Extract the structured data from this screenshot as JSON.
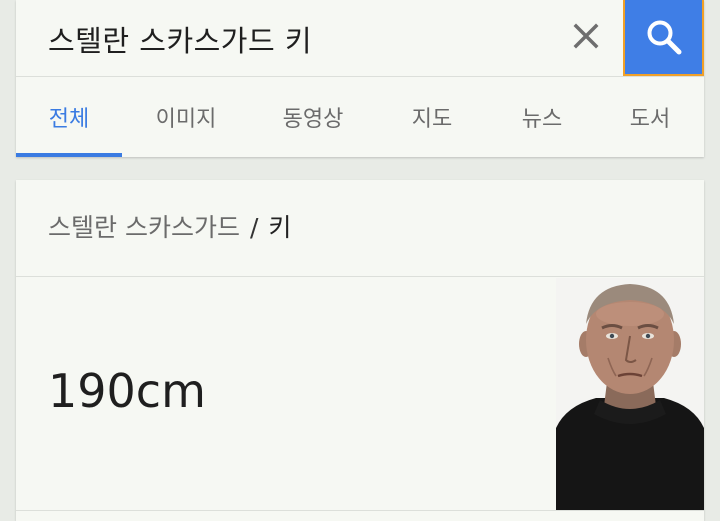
{
  "search": {
    "query": "스텔란 스카스가드 키",
    "clear_icon": "close-icon",
    "search_icon": "search-icon",
    "accent_color": "#3f7ee6"
  },
  "tabs": [
    {
      "label": "전체",
      "active": true
    },
    {
      "label": "이미지",
      "active": false
    },
    {
      "label": "동영상",
      "active": false
    },
    {
      "label": "지도",
      "active": false
    },
    {
      "label": "뉴스",
      "active": false
    },
    {
      "label": "도서",
      "active": false
    }
  ],
  "answer": {
    "breadcrumb_entity": "스텔란 스카스가드",
    "breadcrumb_separator": "/",
    "breadcrumb_attribute": "키",
    "value": "190cm"
  }
}
